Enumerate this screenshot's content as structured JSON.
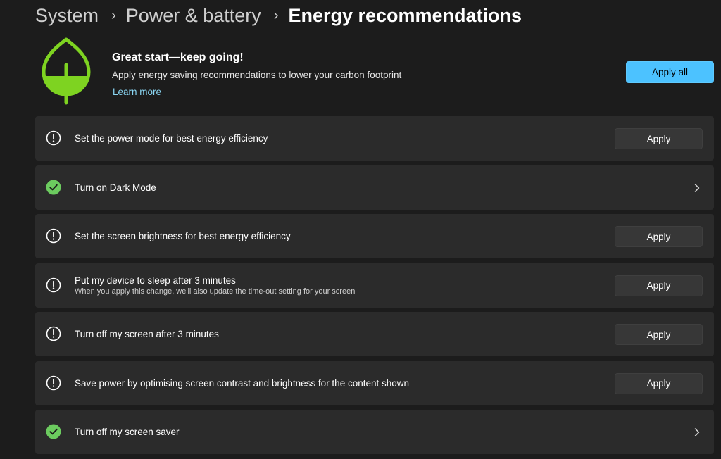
{
  "breadcrumb": {
    "items": [
      "System",
      "Power & battery"
    ],
    "current": "Energy recommendations",
    "separator": "›"
  },
  "hero": {
    "icon": "leaf-icon",
    "title": "Great start—keep going!",
    "description": "Apply energy saving recommendations to lower your carbon footprint",
    "link": "Learn more",
    "apply_all_label": "Apply all"
  },
  "recommendations": [
    {
      "title": "Set the power mode for best energy efficiency",
      "subtitle": "",
      "status": "pending",
      "action": "Apply"
    },
    {
      "title": "Turn on Dark Mode",
      "subtitle": "",
      "status": "done",
      "action": ""
    },
    {
      "title": "Set the screen brightness for best energy efficiency",
      "subtitle": "",
      "status": "pending",
      "action": "Apply"
    },
    {
      "title": "Put my device to sleep after 3 minutes",
      "subtitle": "When you apply this change, we'll also update the time-out setting for your screen",
      "status": "pending",
      "action": "Apply"
    },
    {
      "title": "Turn off my screen after 3 minutes",
      "subtitle": "",
      "status": "pending",
      "action": "Apply"
    },
    {
      "title": "Save power by optimising screen contrast and brightness for the content shown",
      "subtitle": "",
      "status": "pending",
      "action": "Apply"
    },
    {
      "title": "Turn off my screen saver",
      "subtitle": "",
      "status": "done",
      "action": ""
    }
  ],
  "colors": {
    "background": "#1c1c1c",
    "card": "#2b2b2b",
    "accent": "#4cc2ff",
    "link": "#8ad6f3",
    "leaf": "#7ed321",
    "success": "#6ccb5f"
  }
}
